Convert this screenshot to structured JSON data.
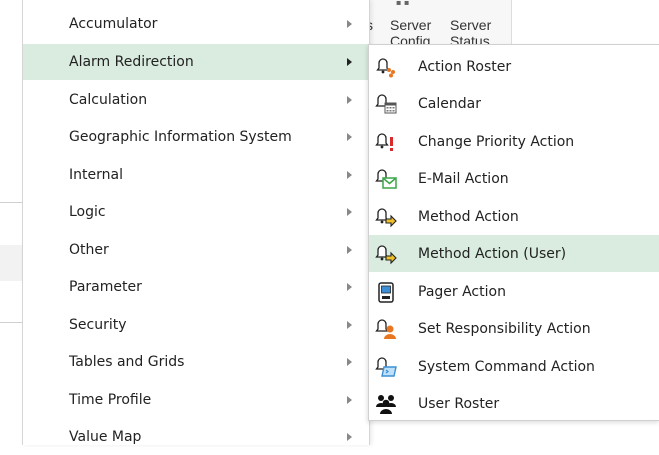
{
  "background": {
    "columns": [
      {
        "line1": "s",
        "line2": ""
      },
      {
        "line1": "Server",
        "line2": "Config"
      },
      {
        "line1": "Server",
        "line2": "Status"
      }
    ]
  },
  "menu": {
    "items": [
      {
        "label": "Accumulator",
        "highlighted": false
      },
      {
        "label": "Alarm Redirection",
        "highlighted": true
      },
      {
        "label": "Calculation",
        "highlighted": false
      },
      {
        "label": "Geographic Information System",
        "highlighted": false
      },
      {
        "label": "Internal",
        "highlighted": false
      },
      {
        "label": "Logic",
        "highlighted": false
      },
      {
        "label": "Other",
        "highlighted": false
      },
      {
        "label": "Parameter",
        "highlighted": false
      },
      {
        "label": "Security",
        "highlighted": false
      },
      {
        "label": "Tables and Grids",
        "highlighted": false
      },
      {
        "label": "Time Profile",
        "highlighted": false
      },
      {
        "label": "Value Map",
        "highlighted": false
      }
    ]
  },
  "submenu": {
    "items": [
      {
        "label": "Action Roster",
        "icon": "action-roster-icon",
        "highlighted": false
      },
      {
        "label": "Calendar",
        "icon": "calendar-icon",
        "highlighted": false
      },
      {
        "label": "Change Priority Action",
        "icon": "change-priority-icon",
        "highlighted": false
      },
      {
        "label": "E-Mail Action",
        "icon": "email-icon",
        "highlighted": false
      },
      {
        "label": "Method Action",
        "icon": "method-icon",
        "highlighted": false
      },
      {
        "label": "Method Action (User)",
        "icon": "method-user-icon",
        "highlighted": true
      },
      {
        "label": "Pager Action",
        "icon": "pager-icon",
        "highlighted": false
      },
      {
        "label": "Set Responsibility Action",
        "icon": "responsibility-icon",
        "highlighted": false
      },
      {
        "label": "System Command Action",
        "icon": "system-command-icon",
        "highlighted": false
      },
      {
        "label": "User Roster",
        "icon": "user-roster-icon",
        "highlighted": false
      }
    ]
  },
  "colors": {
    "highlight": "#d9ecdf",
    "accent_orange": "#e87722",
    "accent_green": "#3aa64a",
    "accent_blue": "#3c8fd6",
    "accent_red": "#d92b2b"
  }
}
